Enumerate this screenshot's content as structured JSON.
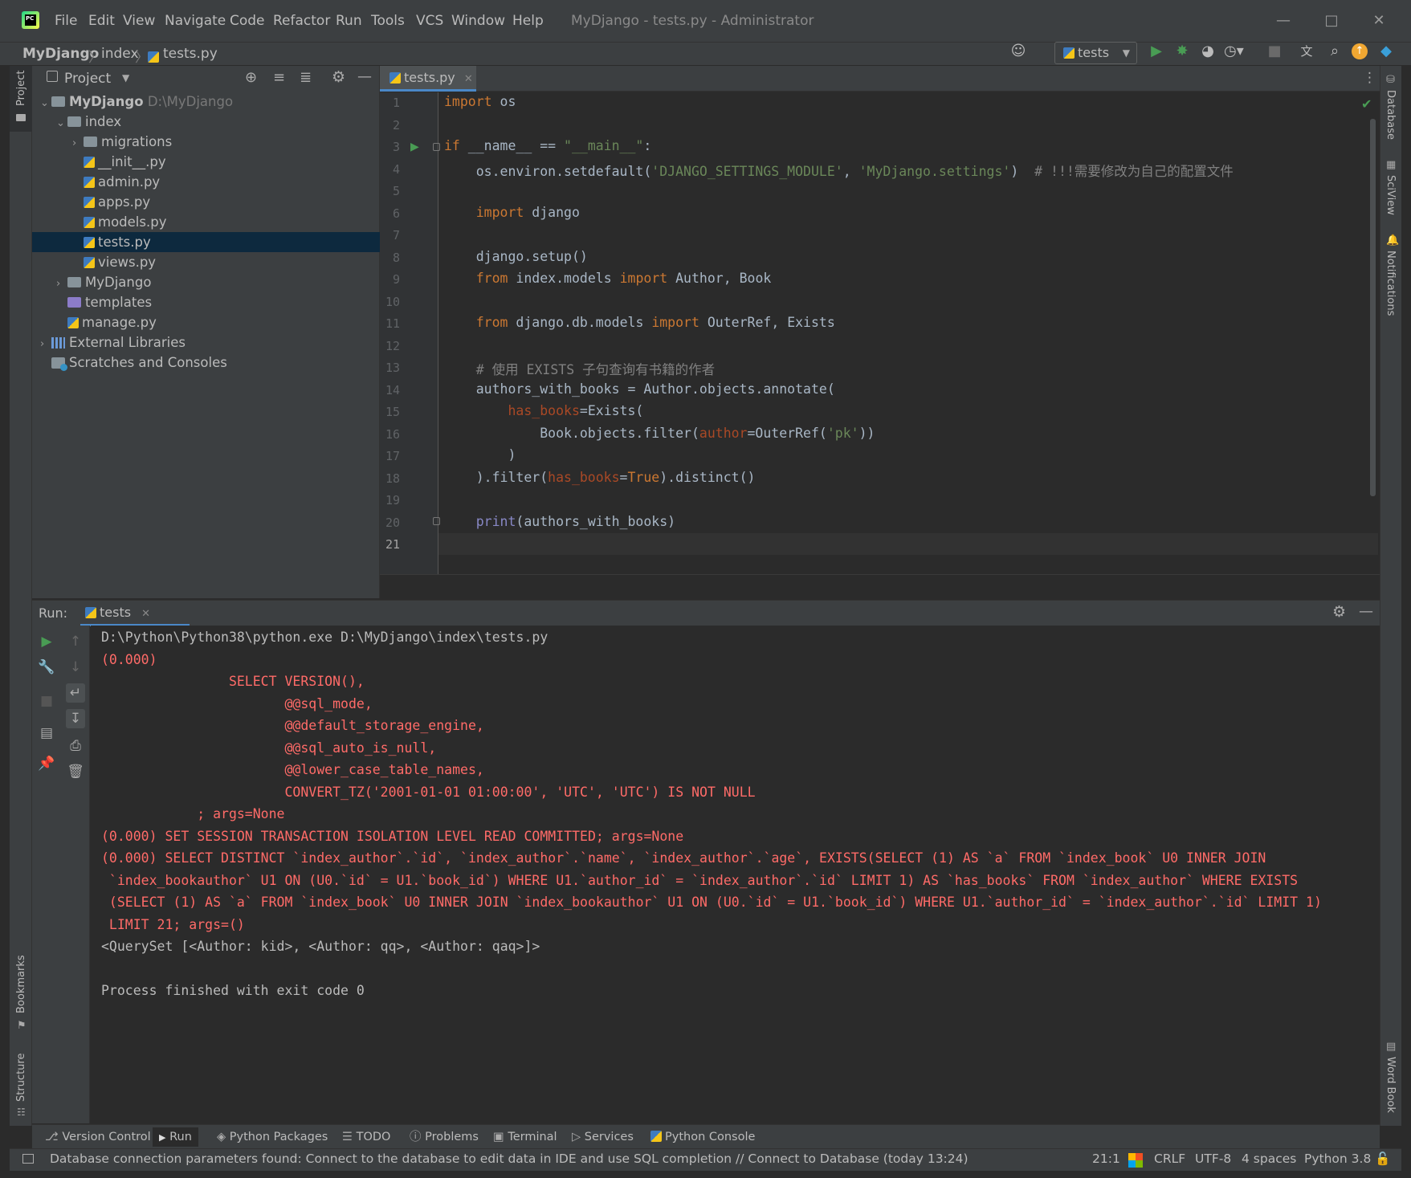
{
  "window": {
    "title": "MyDjango - tests.py - Administrator",
    "menu": [
      "File",
      "Edit",
      "View",
      "Navigate",
      "Code",
      "Refactor",
      "Run",
      "Tools",
      "VCS",
      "Window",
      "Help"
    ]
  },
  "navbar": {
    "breadcrumbs": [
      "MyDjango",
      "index",
      "tests.py"
    ],
    "run_config": "tests"
  },
  "left_stripe": {
    "top": "Project",
    "bottom1": "Bookmarks",
    "bottom2": "Structure"
  },
  "right_stripe": [
    "Database",
    "SciView",
    "Notifications",
    "Word Book"
  ],
  "project": {
    "title": "Project",
    "tree": [
      {
        "label": "MyDjango",
        "suffix": "D:\\MyDjango",
        "depth": 0,
        "type": "root",
        "expanded": true
      },
      {
        "label": "index",
        "depth": 1,
        "type": "folder",
        "expanded": true
      },
      {
        "label": "migrations",
        "depth": 2,
        "type": "folder",
        "expanded": false
      },
      {
        "label": "__init__.py",
        "depth": 2,
        "type": "py"
      },
      {
        "label": "admin.py",
        "depth": 2,
        "type": "py"
      },
      {
        "label": "apps.py",
        "depth": 2,
        "type": "py"
      },
      {
        "label": "models.py",
        "depth": 2,
        "type": "py"
      },
      {
        "label": "tests.py",
        "depth": 2,
        "type": "py",
        "selected": true
      },
      {
        "label": "views.py",
        "depth": 2,
        "type": "py"
      },
      {
        "label": "MyDjango",
        "depth": 1,
        "type": "folder",
        "expanded": false
      },
      {
        "label": "templates",
        "depth": 1,
        "type": "purple"
      },
      {
        "label": "manage.py",
        "depth": 1,
        "type": "py"
      },
      {
        "label": "External Libraries",
        "depth": 0,
        "type": "lib",
        "expanded": false
      },
      {
        "label": "Scratches and Consoles",
        "depth": 0,
        "type": "scratch"
      }
    ]
  },
  "editor": {
    "tab": "tests.py",
    "line_numbers": [
      "1",
      "2",
      "3",
      "4",
      "5",
      "6",
      "7",
      "8",
      "9",
      "10",
      "11",
      "12",
      "13",
      "14",
      "15",
      "16",
      "17",
      "18",
      "19",
      "20",
      "21"
    ]
  },
  "run": {
    "label": "Run:",
    "tab": "tests",
    "output": [
      {
        "text": "D:\\Python\\Python38\\python.exe D:\\MyDjango\\index\\tests.py",
        "err": false
      },
      {
        "text": "(0.000)",
        "err": true
      },
      {
        "text": "                SELECT VERSION(),",
        "err": true
      },
      {
        "text": "                       @@sql_mode,",
        "err": true
      },
      {
        "text": "                       @@default_storage_engine,",
        "err": true
      },
      {
        "text": "                       @@sql_auto_is_null,",
        "err": true
      },
      {
        "text": "                       @@lower_case_table_names,",
        "err": true
      },
      {
        "text": "                       CONVERT_TZ('2001-01-01 01:00:00', 'UTC', 'UTC') IS NOT NULL",
        "err": true
      },
      {
        "text": "            ; args=None",
        "err": true
      },
      {
        "text": "(0.000) SET SESSION TRANSACTION ISOLATION LEVEL READ COMMITTED; args=None",
        "err": true
      },
      {
        "text": "(0.000) SELECT DISTINCT `index_author`.`id`, `index_author`.`name`, `index_author`.`age`, EXISTS(SELECT (1) AS `a` FROM `index_book` U0 INNER JOIN",
        "err": true
      },
      {
        "text": " `index_bookauthor` U1 ON (U0.`id` = U1.`book_id`) WHERE U1.`author_id` = `index_author`.`id` LIMIT 1) AS `has_books` FROM `index_author` WHERE EXISTS",
        "err": true
      },
      {
        "text": " (SELECT (1) AS `a` FROM `index_book` U0 INNER JOIN `index_bookauthor` U1 ON (U0.`id` = U1.`book_id`) WHERE U1.`author_id` = `index_author`.`id` LIMIT 1)",
        "err": true
      },
      {
        "text": " LIMIT 21; args=()",
        "err": true
      },
      {
        "text": "<QuerySet [<Author: kid>, <Author: qq>, <Author: qaq>]>",
        "err": false
      },
      {
        "text": "",
        "err": false
      },
      {
        "text": "Process finished with exit code 0",
        "err": false
      }
    ]
  },
  "bottom_tabs": [
    "Version Control",
    "Run",
    "Python Packages",
    "TODO",
    "Problems",
    "Terminal",
    "Services",
    "Python Console"
  ],
  "status": {
    "message": "Database connection parameters found: Connect to the database to edit data in IDE and use SQL completion // Connect to Database (today 13:24)",
    "position": "21:1",
    "line_sep": "CRLF",
    "encoding": "UTF-8",
    "indent": "4 spaces",
    "interpreter": "Python 3.8"
  },
  "colors": {
    "keyword": "#cc7832",
    "string": "#6a8759",
    "comment": "#808080",
    "error_output": "#ff6b68",
    "selection": "#0d293e",
    "run_green": "#499c54"
  }
}
